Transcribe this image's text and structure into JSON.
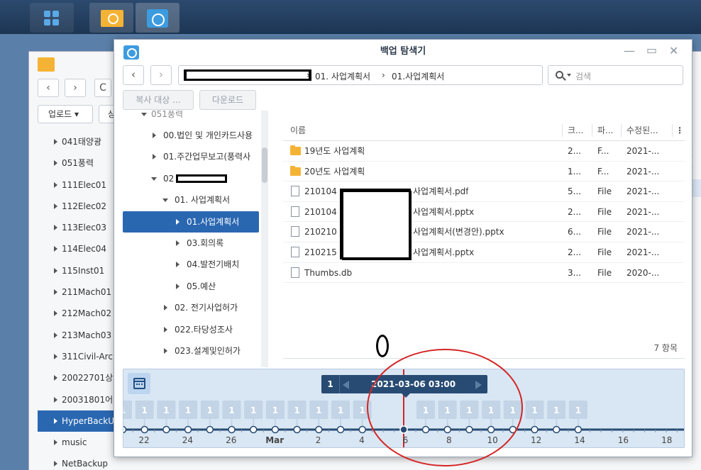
{
  "backup_explorer": {
    "title": "백업 탐색기",
    "path_segments": [
      "01. 사업계획서",
      "01.사업계획서"
    ],
    "search_placeholder": "검색",
    "copy_to_label": "복사 대상 ...",
    "download_label": "다운로드"
  },
  "tree": {
    "partial_top": "051풍력",
    "nodes": [
      {
        "label": "00.법인 및 개인카드사용",
        "level": 1,
        "state": "collapsed"
      },
      {
        "label": "01.주간업무보고(풍력사",
        "level": 1,
        "state": "collapsed"
      },
      {
        "label": "02",
        "level": 1,
        "state": "expanded",
        "redacted": true
      },
      {
        "label": "01. 사업계획서",
        "level": 2,
        "state": "expanded"
      },
      {
        "label": "01.사업계획서",
        "level": 3,
        "state": "collapsed",
        "selected": true
      },
      {
        "label": "03.회의록",
        "level": 3,
        "state": "collapsed"
      },
      {
        "label": "04.발전기배치",
        "level": 3,
        "state": "collapsed"
      },
      {
        "label": "05.예산",
        "level": 3,
        "state": "collapsed"
      },
      {
        "label": "02. 전기사업허가",
        "level": 2,
        "state": "collapsed"
      },
      {
        "label": "022.타당성조사",
        "level": 2,
        "state": "collapsed"
      },
      {
        "label": "023.설계및인허가",
        "level": 2,
        "state": "collapsed"
      }
    ]
  },
  "file_list": {
    "columns": [
      "이름",
      "크...",
      "파...",
      "수정된..."
    ],
    "menu_glyph": "⋮",
    "rows": [
      {
        "name": "19년도 사업계획",
        "size": "2...",
        "type": "F...",
        "modified": "2021-...",
        "icon": "folder-icon"
      },
      {
        "name": "20년도 사업계획",
        "size": "1...",
        "type": "F...",
        "modified": "2021-...",
        "icon": "folder-icon"
      },
      {
        "name": "210104",
        "suffix": "사업계획서.pdf",
        "size": "5...",
        "type": "File",
        "modified": "2021-...",
        "icon": "file-icon"
      },
      {
        "name": "210104",
        "suffix": "사업계획서.pptx",
        "size": "2...",
        "type": "File",
        "modified": "2021-...",
        "icon": "file-icon"
      },
      {
        "name": "210210",
        "suffix": "사업계획서(변경안).pptx",
        "size": "6...",
        "type": "File",
        "modified": "2021-...",
        "icon": "file-icon"
      },
      {
        "name": "210215",
        "suffix": "사업계획서.pptx",
        "size": "2...",
        "type": "File",
        "modified": "2021-...",
        "icon": "file-icon"
      },
      {
        "name": "Thumbs.db",
        "size": "3...",
        "type": "File",
        "modified": "2020-...",
        "icon": "file-icon"
      }
    ],
    "item_count": "7 항목"
  },
  "timeline": {
    "selected_count": "1",
    "selected_datetime": "2021-03-06 03:00",
    "version_badges": [
      "1",
      "1",
      "1",
      "1",
      "1",
      "1",
      "1",
      "1",
      "1",
      "1",
      "1",
      "1",
      "1",
      "1",
      "1",
      "1",
      "1",
      "1",
      "1",
      "1",
      "1",
      "1"
    ],
    "axis_labels": [
      "22",
      "24",
      "26",
      "Mar",
      "2",
      "4",
      "6",
      "8",
      "10",
      "12",
      "14",
      "16",
      "18"
    ]
  },
  "file_station": {
    "upload_label": "업로드",
    "second_button": "상",
    "tree_items": [
      "041태양광",
      "051풍력",
      "111Elec01",
      "112Elec02",
      "113Elec03",
      "114Elec04",
      "115Inst01",
      "211Mach01",
      "212Mach02",
      "213Mach03",
      "311Civil-Arc",
      "20022701상",
      "20031801어",
      "HyperBackU",
      "music",
      "NetBackup"
    ],
    "selected_tree_item": "HyperBackU",
    "right_edge_text": [
      "-(",
      "-(",
      "-("
    ]
  },
  "annotation": {
    "mark": "0"
  },
  "colors": {
    "selection_blue": "#2a67b1",
    "timeline_bg": "#d9e7f4",
    "timeline_axis": "#274b73",
    "marker_red": "#d42525",
    "folder_yellow": "#f5b335"
  }
}
